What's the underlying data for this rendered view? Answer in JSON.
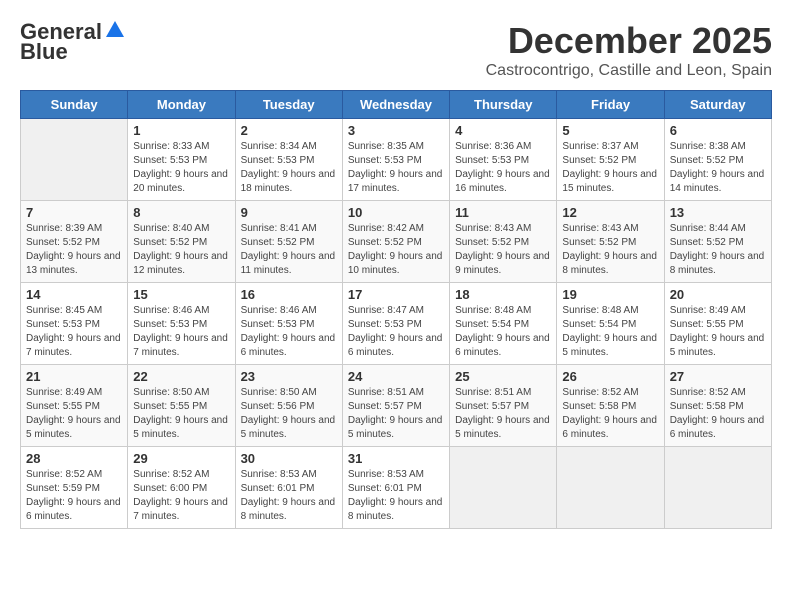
{
  "logo": {
    "general": "General",
    "blue": "Blue"
  },
  "title": "December 2025",
  "location": "Castrocontrigo, Castille and Leon, Spain",
  "days_of_week": [
    "Sunday",
    "Monday",
    "Tuesday",
    "Wednesday",
    "Thursday",
    "Friday",
    "Saturday"
  ],
  "weeks": [
    [
      {
        "day": "",
        "sunrise": "",
        "sunset": "",
        "daylight": ""
      },
      {
        "day": "1",
        "sunrise": "Sunrise: 8:33 AM",
        "sunset": "Sunset: 5:53 PM",
        "daylight": "Daylight: 9 hours and 20 minutes."
      },
      {
        "day": "2",
        "sunrise": "Sunrise: 8:34 AM",
        "sunset": "Sunset: 5:53 PM",
        "daylight": "Daylight: 9 hours and 18 minutes."
      },
      {
        "day": "3",
        "sunrise": "Sunrise: 8:35 AM",
        "sunset": "Sunset: 5:53 PM",
        "daylight": "Daylight: 9 hours and 17 minutes."
      },
      {
        "day": "4",
        "sunrise": "Sunrise: 8:36 AM",
        "sunset": "Sunset: 5:53 PM",
        "daylight": "Daylight: 9 hours and 16 minutes."
      },
      {
        "day": "5",
        "sunrise": "Sunrise: 8:37 AM",
        "sunset": "Sunset: 5:52 PM",
        "daylight": "Daylight: 9 hours and 15 minutes."
      },
      {
        "day": "6",
        "sunrise": "Sunrise: 8:38 AM",
        "sunset": "Sunset: 5:52 PM",
        "daylight": "Daylight: 9 hours and 14 minutes."
      }
    ],
    [
      {
        "day": "7",
        "sunrise": "Sunrise: 8:39 AM",
        "sunset": "Sunset: 5:52 PM",
        "daylight": "Daylight: 9 hours and 13 minutes."
      },
      {
        "day": "8",
        "sunrise": "Sunrise: 8:40 AM",
        "sunset": "Sunset: 5:52 PM",
        "daylight": "Daylight: 9 hours and 12 minutes."
      },
      {
        "day": "9",
        "sunrise": "Sunrise: 8:41 AM",
        "sunset": "Sunset: 5:52 PM",
        "daylight": "Daylight: 9 hours and 11 minutes."
      },
      {
        "day": "10",
        "sunrise": "Sunrise: 8:42 AM",
        "sunset": "Sunset: 5:52 PM",
        "daylight": "Daylight: 9 hours and 10 minutes."
      },
      {
        "day": "11",
        "sunrise": "Sunrise: 8:43 AM",
        "sunset": "Sunset: 5:52 PM",
        "daylight": "Daylight: 9 hours and 9 minutes."
      },
      {
        "day": "12",
        "sunrise": "Sunrise: 8:43 AM",
        "sunset": "Sunset: 5:52 PM",
        "daylight": "Daylight: 9 hours and 8 minutes."
      },
      {
        "day": "13",
        "sunrise": "Sunrise: 8:44 AM",
        "sunset": "Sunset: 5:52 PM",
        "daylight": "Daylight: 9 hours and 8 minutes."
      }
    ],
    [
      {
        "day": "14",
        "sunrise": "Sunrise: 8:45 AM",
        "sunset": "Sunset: 5:53 PM",
        "daylight": "Daylight: 9 hours and 7 minutes."
      },
      {
        "day": "15",
        "sunrise": "Sunrise: 8:46 AM",
        "sunset": "Sunset: 5:53 PM",
        "daylight": "Daylight: 9 hours and 7 minutes."
      },
      {
        "day": "16",
        "sunrise": "Sunrise: 8:46 AM",
        "sunset": "Sunset: 5:53 PM",
        "daylight": "Daylight: 9 hours and 6 minutes."
      },
      {
        "day": "17",
        "sunrise": "Sunrise: 8:47 AM",
        "sunset": "Sunset: 5:53 PM",
        "daylight": "Daylight: 9 hours and 6 minutes."
      },
      {
        "day": "18",
        "sunrise": "Sunrise: 8:48 AM",
        "sunset": "Sunset: 5:54 PM",
        "daylight": "Daylight: 9 hours and 6 minutes."
      },
      {
        "day": "19",
        "sunrise": "Sunrise: 8:48 AM",
        "sunset": "Sunset: 5:54 PM",
        "daylight": "Daylight: 9 hours and 5 minutes."
      },
      {
        "day": "20",
        "sunrise": "Sunrise: 8:49 AM",
        "sunset": "Sunset: 5:55 PM",
        "daylight": "Daylight: 9 hours and 5 minutes."
      }
    ],
    [
      {
        "day": "21",
        "sunrise": "Sunrise: 8:49 AM",
        "sunset": "Sunset: 5:55 PM",
        "daylight": "Daylight: 9 hours and 5 minutes."
      },
      {
        "day": "22",
        "sunrise": "Sunrise: 8:50 AM",
        "sunset": "Sunset: 5:55 PM",
        "daylight": "Daylight: 9 hours and 5 minutes."
      },
      {
        "day": "23",
        "sunrise": "Sunrise: 8:50 AM",
        "sunset": "Sunset: 5:56 PM",
        "daylight": "Daylight: 9 hours and 5 minutes."
      },
      {
        "day": "24",
        "sunrise": "Sunrise: 8:51 AM",
        "sunset": "Sunset: 5:57 PM",
        "daylight": "Daylight: 9 hours and 5 minutes."
      },
      {
        "day": "25",
        "sunrise": "Sunrise: 8:51 AM",
        "sunset": "Sunset: 5:57 PM",
        "daylight": "Daylight: 9 hours and 5 minutes."
      },
      {
        "day": "26",
        "sunrise": "Sunrise: 8:52 AM",
        "sunset": "Sunset: 5:58 PM",
        "daylight": "Daylight: 9 hours and 6 minutes."
      },
      {
        "day": "27",
        "sunrise": "Sunrise: 8:52 AM",
        "sunset": "Sunset: 5:58 PM",
        "daylight": "Daylight: 9 hours and 6 minutes."
      }
    ],
    [
      {
        "day": "28",
        "sunrise": "Sunrise: 8:52 AM",
        "sunset": "Sunset: 5:59 PM",
        "daylight": "Daylight: 9 hours and 6 minutes."
      },
      {
        "day": "29",
        "sunrise": "Sunrise: 8:52 AM",
        "sunset": "Sunset: 6:00 PM",
        "daylight": "Daylight: 9 hours and 7 minutes."
      },
      {
        "day": "30",
        "sunrise": "Sunrise: 8:53 AM",
        "sunset": "Sunset: 6:01 PM",
        "daylight": "Daylight: 9 hours and 8 minutes."
      },
      {
        "day": "31",
        "sunrise": "Sunrise: 8:53 AM",
        "sunset": "Sunset: 6:01 PM",
        "daylight": "Daylight: 9 hours and 8 minutes."
      },
      {
        "day": "",
        "sunrise": "",
        "sunset": "",
        "daylight": ""
      },
      {
        "day": "",
        "sunrise": "",
        "sunset": "",
        "daylight": ""
      },
      {
        "day": "",
        "sunrise": "",
        "sunset": "",
        "daylight": ""
      }
    ]
  ]
}
